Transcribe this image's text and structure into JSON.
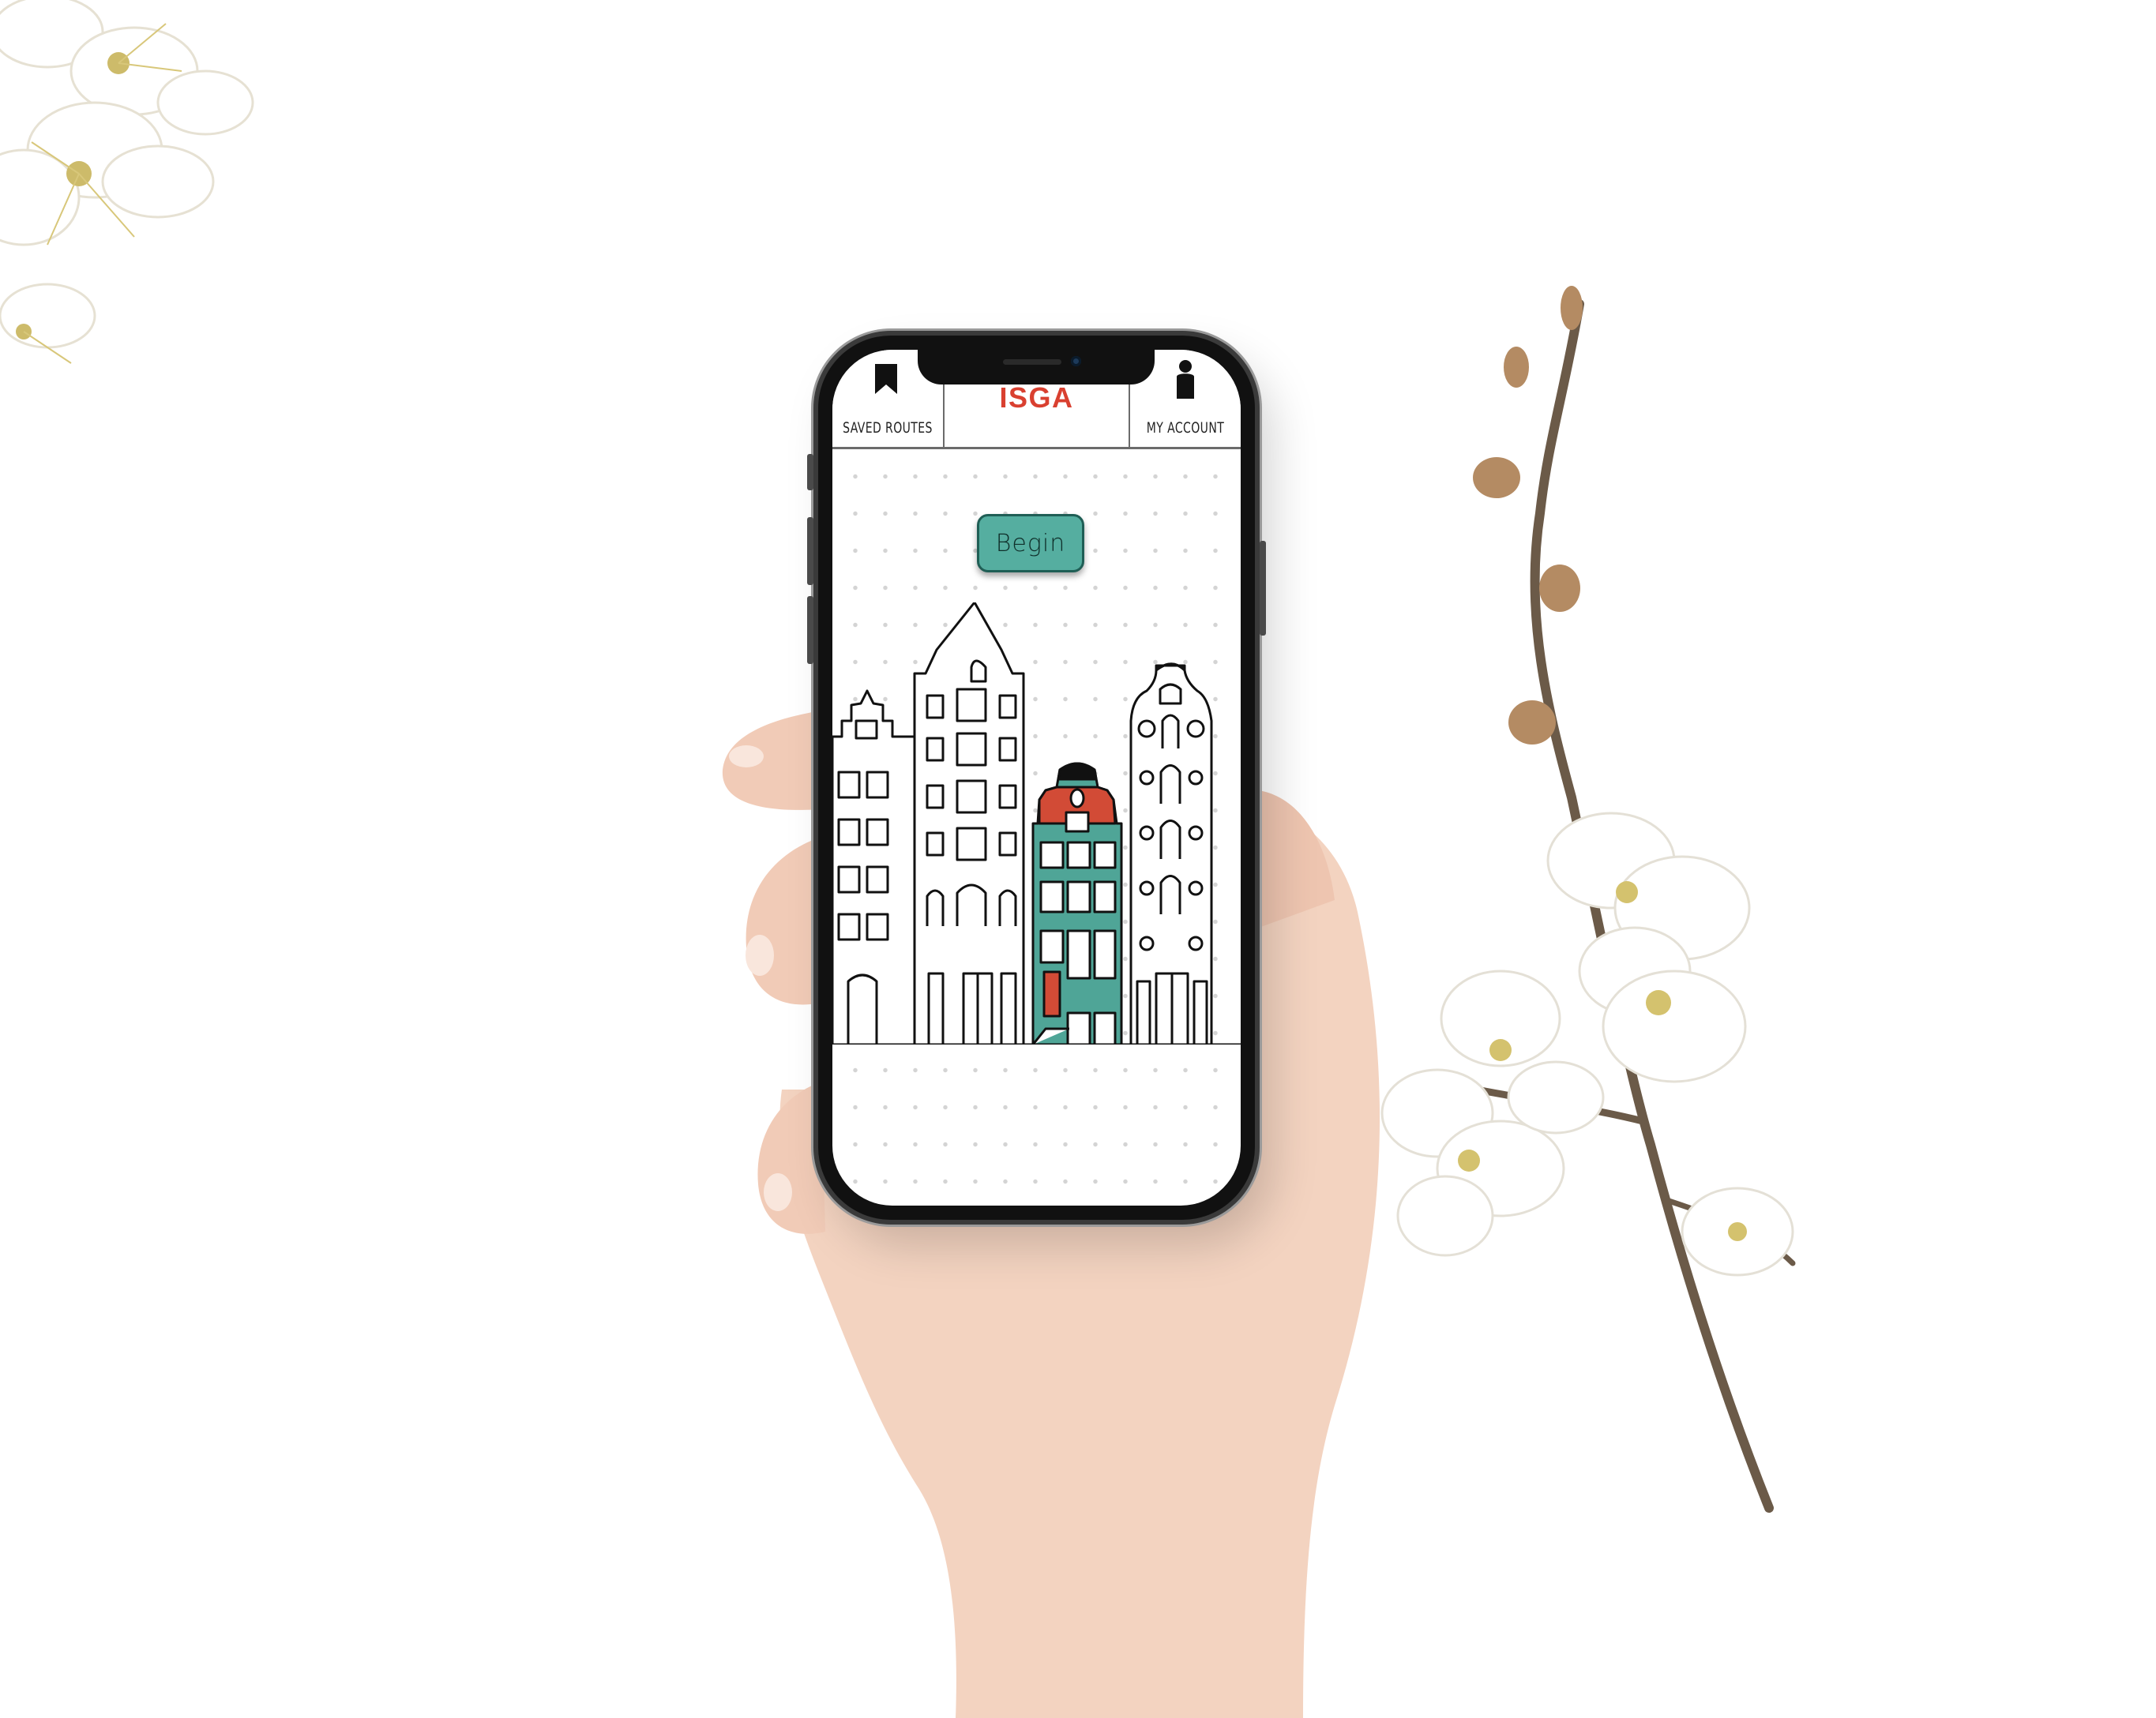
{
  "app": {
    "brand": "ISGA",
    "brand_color": "#d94030",
    "accent_color": "#55aea0"
  },
  "nav": {
    "saved_routes": {
      "label": "SAVED ROUTES",
      "icon": "bookmark-icon"
    },
    "my_account": {
      "label": "MY ACCOUNT",
      "icon": "person-icon"
    }
  },
  "main": {
    "begin_label": "Begin",
    "illustration": "canal-houses-illustration"
  }
}
